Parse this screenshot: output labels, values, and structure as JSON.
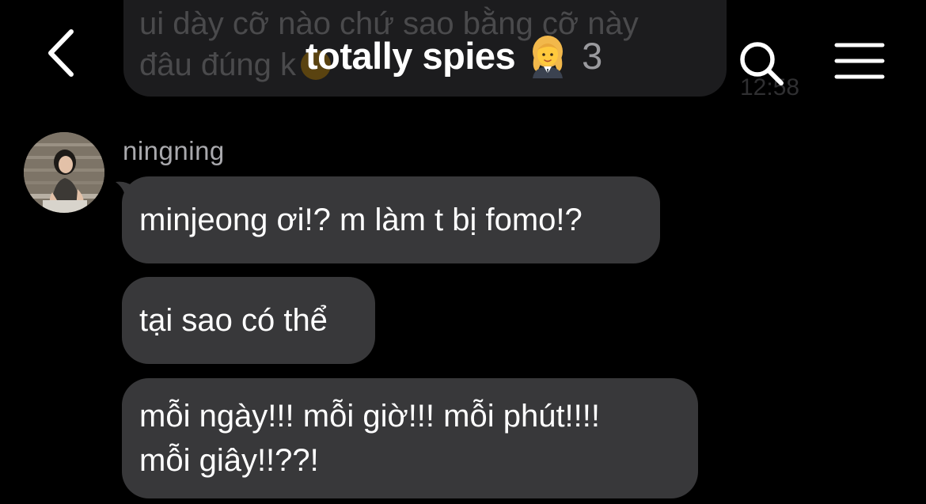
{
  "previous_message": {
    "text": "ui dày cỡ nào chứ sao bằng cỡ này\nđâu đúng k",
    "time": "12:58"
  },
  "header": {
    "back_icon": "chevron-left-icon",
    "title": "totally spies",
    "title_emoji": "woman-office-worker-emoji",
    "member_count": "3",
    "search_icon": "search-icon",
    "menu_icon": "hamburger-menu-icon"
  },
  "sender": {
    "name": "ningning"
  },
  "messages": [
    {
      "text": "minjeong ơi!? m làm t bị fomo!?"
    },
    {
      "text": "tại sao có thể"
    },
    {
      "text": "mỗi ngày!!! mỗi giờ!!! mỗi phút!!!!\nmỗi giây!!??!"
    }
  ],
  "colors": {
    "background": "#000000",
    "bubble": "#38383a",
    "faded_bubble": "#1c1c1e",
    "sender_name": "#a9a9ad",
    "member_count": "#9a9a9e"
  }
}
